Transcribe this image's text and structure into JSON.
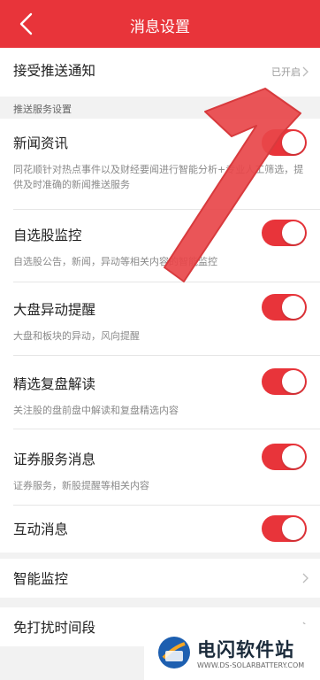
{
  "header": {
    "title": "消息设置"
  },
  "accept_push": {
    "label": "接受推送通知",
    "status": "已开启"
  },
  "section": {
    "title": "推送服务设置"
  },
  "items": [
    {
      "label": "新闻资讯",
      "desc": "同花顺针对热点事件以及财经要闻进行智能分析+专业人工筛选，提供及时准确的新闻推送服务",
      "on": true
    },
    {
      "label": "自选股监控",
      "desc": "自选股公告，新闻，异动等相关内容的智能监控",
      "on": true
    },
    {
      "label": "大盘异动提醒",
      "desc": "大盘和板块的异动，风向提醒",
      "on": true
    },
    {
      "label": "精选复盘解读",
      "desc": "关注股的盘前盘中解读和复盘精选内容",
      "on": true
    },
    {
      "label": "证券服务消息",
      "desc": "证券服务，新股提醒等相关内容",
      "on": true
    },
    {
      "label": "互动消息",
      "on": true
    }
  ],
  "smart_monitor": {
    "label": "智能监控"
  },
  "dnd": {
    "label": "免打扰时间段"
  },
  "watermark": {
    "title": "电闪软件站",
    "subtitle": "WWW.DS-SOLARBATTERY.COM"
  },
  "colors": {
    "accent": "#e8343a",
    "background": "#f2f2f2"
  },
  "icons": [
    "back-arrow-icon",
    "chevron-right-icon"
  ]
}
